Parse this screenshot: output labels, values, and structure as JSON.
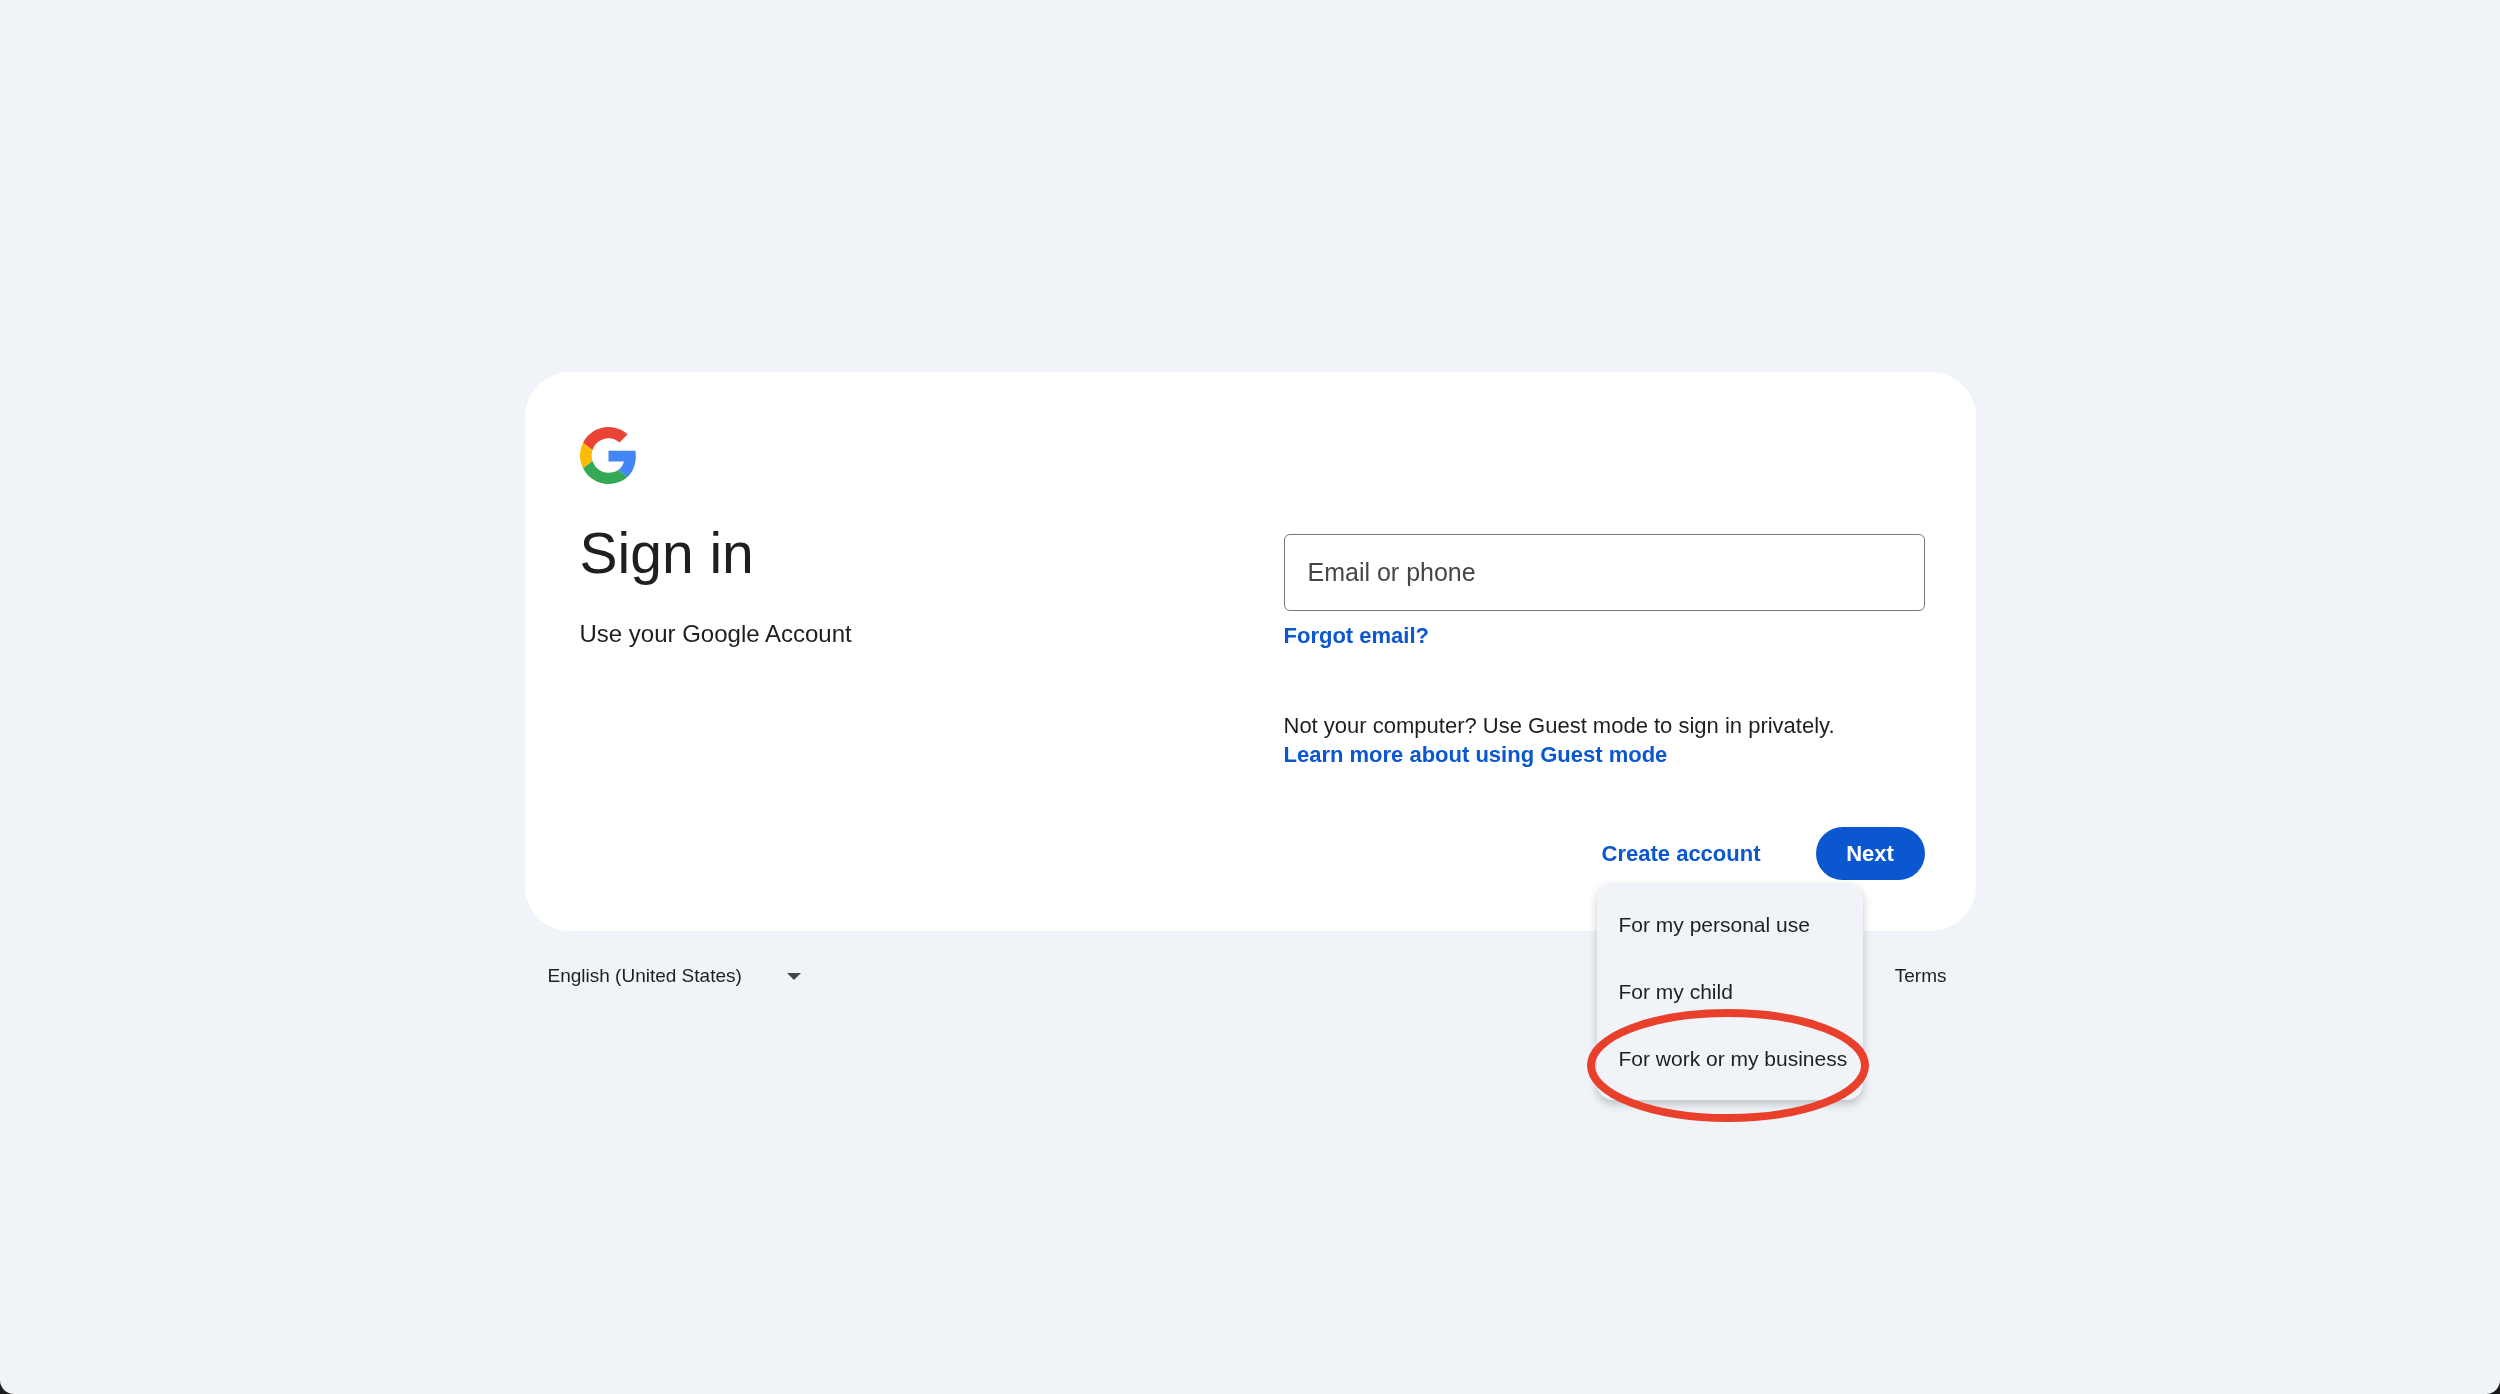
{
  "heading": {
    "title": "Sign in",
    "subtitle": "Use your Google Account"
  },
  "email_field": {
    "placeholder": "Email or phone"
  },
  "forgot_email_link": "Forgot email?",
  "guest_notice": {
    "text": "Not your computer? Use Guest mode to sign in privately.",
    "link": "Learn more about using Guest mode"
  },
  "actions": {
    "create_account": "Create account",
    "next": "Next"
  },
  "create_account_menu": {
    "items": [
      {
        "label": "For my personal use",
        "circled": false
      },
      {
        "label": "For my child",
        "circled": false
      },
      {
        "label": "For work or my business",
        "circled": true
      }
    ]
  },
  "footer": {
    "language": "English (United States)",
    "links": [
      "Terms"
    ]
  }
}
